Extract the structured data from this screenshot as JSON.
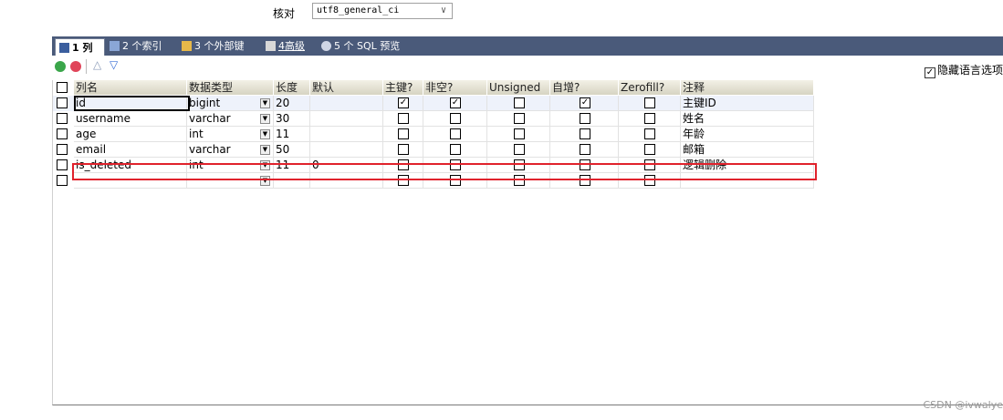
{
  "collation": {
    "label": "核对",
    "value": "utf8_general_ci"
  },
  "tabs": [
    {
      "label": "1 列",
      "icon": "columns-icon",
      "active": true
    },
    {
      "label": "2 个索引",
      "icon": "index-icon"
    },
    {
      "label": "3 个外部键",
      "icon": "foreign-key-icon"
    },
    {
      "label": "4高级",
      "icon": "advanced-icon"
    },
    {
      "label": "5 个 SQL 预览",
      "icon": "sql-preview-icon"
    }
  ],
  "toolbar": {
    "hide_lang_label": "隐藏语言选项",
    "hide_lang_checked": true
  },
  "columns": [
    "列名",
    "数据类型",
    "长度",
    "默认",
    "主键?",
    "非空?",
    "Unsigned",
    "自增?",
    "Zerofill?",
    "注释"
  ],
  "rows": [
    {
      "name": "id",
      "type": "bigint",
      "length": "20",
      "default": "",
      "pk": true,
      "notnull": true,
      "unsigned": false,
      "autoinc": true,
      "zerofill": false,
      "comment": "主键ID"
    },
    {
      "name": "username",
      "type": "varchar",
      "length": "30",
      "default": "",
      "pk": false,
      "notnull": false,
      "unsigned": false,
      "autoinc": false,
      "zerofill": false,
      "comment": "姓名"
    },
    {
      "name": "age",
      "type": "int",
      "length": "11",
      "default": "",
      "pk": false,
      "notnull": false,
      "unsigned": false,
      "autoinc": false,
      "zerofill": false,
      "comment": "年龄"
    },
    {
      "name": "email",
      "type": "varchar",
      "length": "50",
      "default": "",
      "pk": false,
      "notnull": false,
      "unsigned": false,
      "autoinc": false,
      "zerofill": false,
      "comment": "邮箱"
    },
    {
      "name": "is_deleted",
      "type": "int",
      "length": "11",
      "default": "0",
      "pk": false,
      "notnull": false,
      "unsigned": false,
      "autoinc": false,
      "zerofill": false,
      "comment": "逻辑删除"
    },
    {
      "name": "",
      "type": "",
      "length": "",
      "default": "",
      "pk": false,
      "notnull": false,
      "unsigned": false,
      "autoinc": false,
      "zerofill": false,
      "comment": ""
    }
  ],
  "watermark": "CSDN @ivwalye",
  "colors": {
    "tab_bar": "#4a5a7a",
    "highlight": "#e0222c"
  }
}
